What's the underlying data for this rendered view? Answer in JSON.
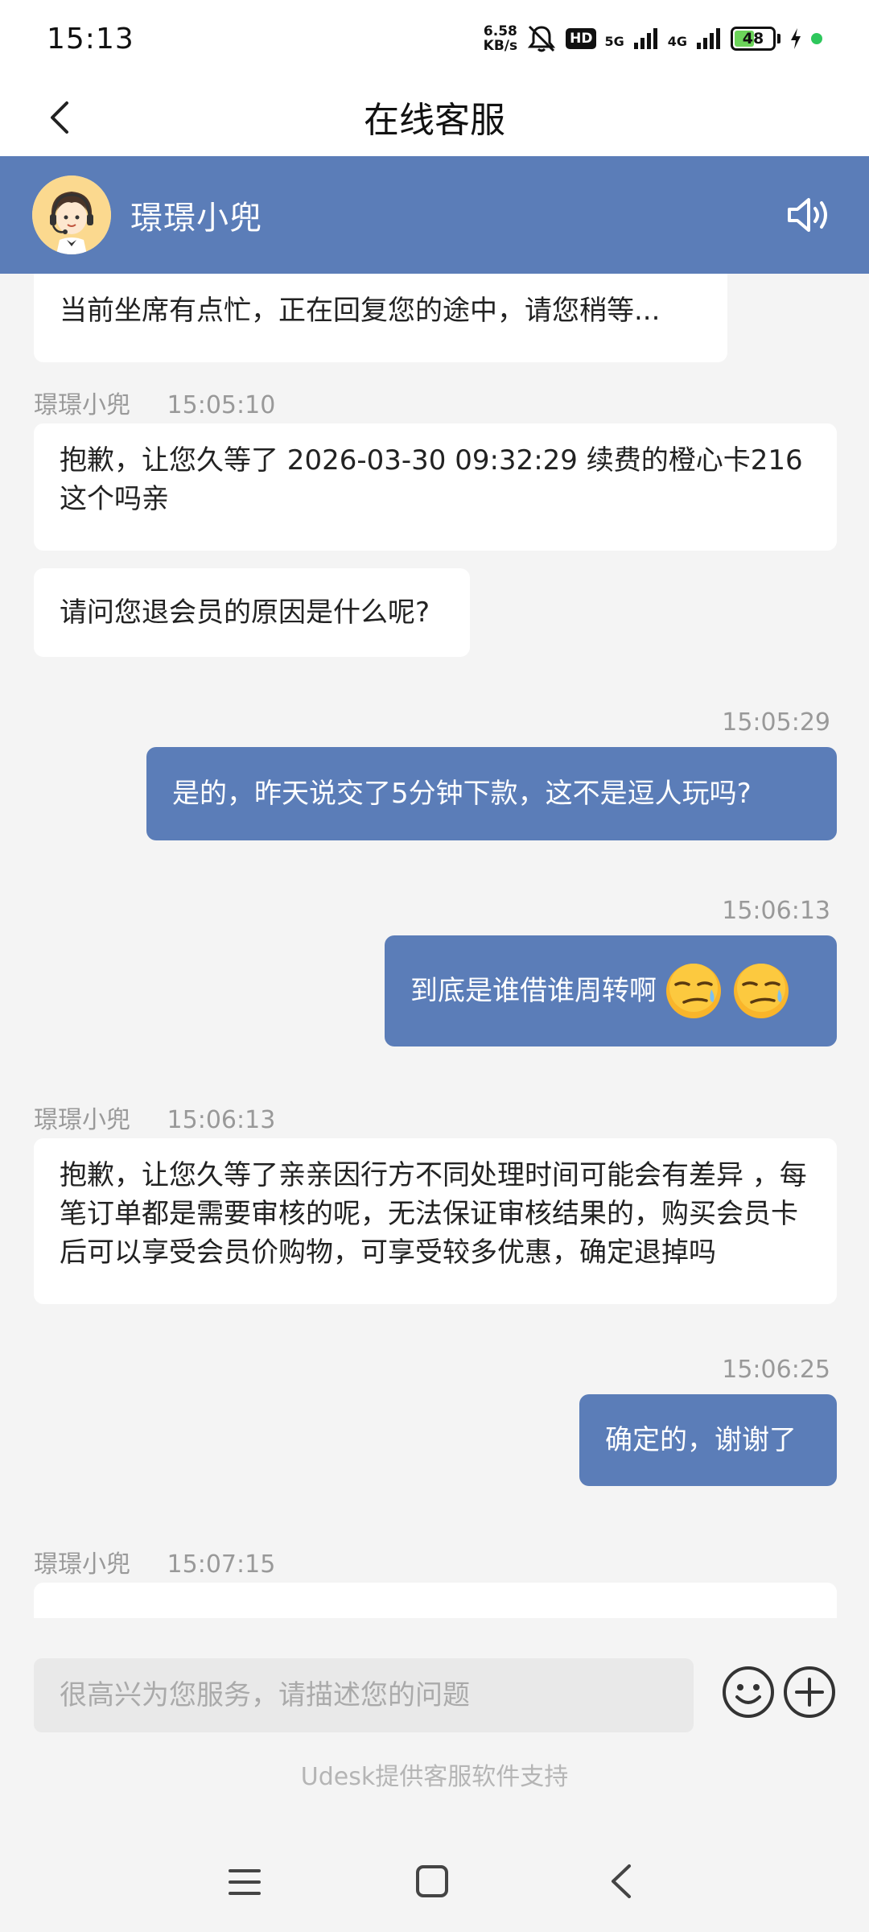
{
  "status_bar": {
    "time": "15:13",
    "net_speed_value": "6.58",
    "net_speed_unit": "KB/s",
    "hd_label": "HD",
    "network_5g": "5G",
    "network_4g": "4G",
    "battery_level": "48",
    "battery_fraction": 0.48
  },
  "title_bar": {
    "title": "在线客服"
  },
  "agent": {
    "name": "璟璟小兜"
  },
  "messages": [
    {
      "direction": "in",
      "text": "当前坐席有点忙，正在回复您的途中，请您稍等..."
    },
    {
      "direction": "in",
      "sender": "璟璟小兜",
      "time": "15:05:10",
      "text": "抱歉，让您久等了 2026-03-30 09:32:29 续费的橙心卡216 这个吗亲"
    },
    {
      "direction": "in",
      "text": "请问您退会员的原因是什么呢?"
    },
    {
      "direction": "out",
      "time": "15:05:29",
      "text": "是的，昨天说交了5分钟下款，这不是逗人玩吗?"
    },
    {
      "direction": "out",
      "time": "15:06:13",
      "text": "到底是谁借谁周转啊"
    },
    {
      "direction": "in",
      "sender": "璟璟小兜",
      "time": "15:06:13",
      "text": "抱歉，让您久等了亲亲因行方不同处理时间可能会有差异 ，每笔订单都是需要审核的呢，无法保证审核结果的，购买会员卡后可以享受会员价购物，可享受较多优惠，确定退掉吗"
    },
    {
      "direction": "out",
      "time": "15:06:25",
      "text": "确定的，谢谢了"
    },
    {
      "direction": "in",
      "sender": "璟璟小兜",
      "time": "15:07:15"
    }
  ],
  "input": {
    "placeholder": "很高兴为您服务，请描述您的问题",
    "value": ""
  },
  "footer": {
    "powered_by": "Udesk提供客服软件支持"
  },
  "colors": {
    "accent": "#5b7db8",
    "background": "#f4f4f4",
    "bubble_in": "#ffffff",
    "meta_text": "#999999"
  },
  "icons": [
    "back-arrow-icon",
    "headset-agent-avatar",
    "speaker-icon",
    "smile-icon",
    "plus-circle-icon",
    "menu-icon",
    "home-icon",
    "nav-back-icon",
    "smirk-emoji"
  ]
}
